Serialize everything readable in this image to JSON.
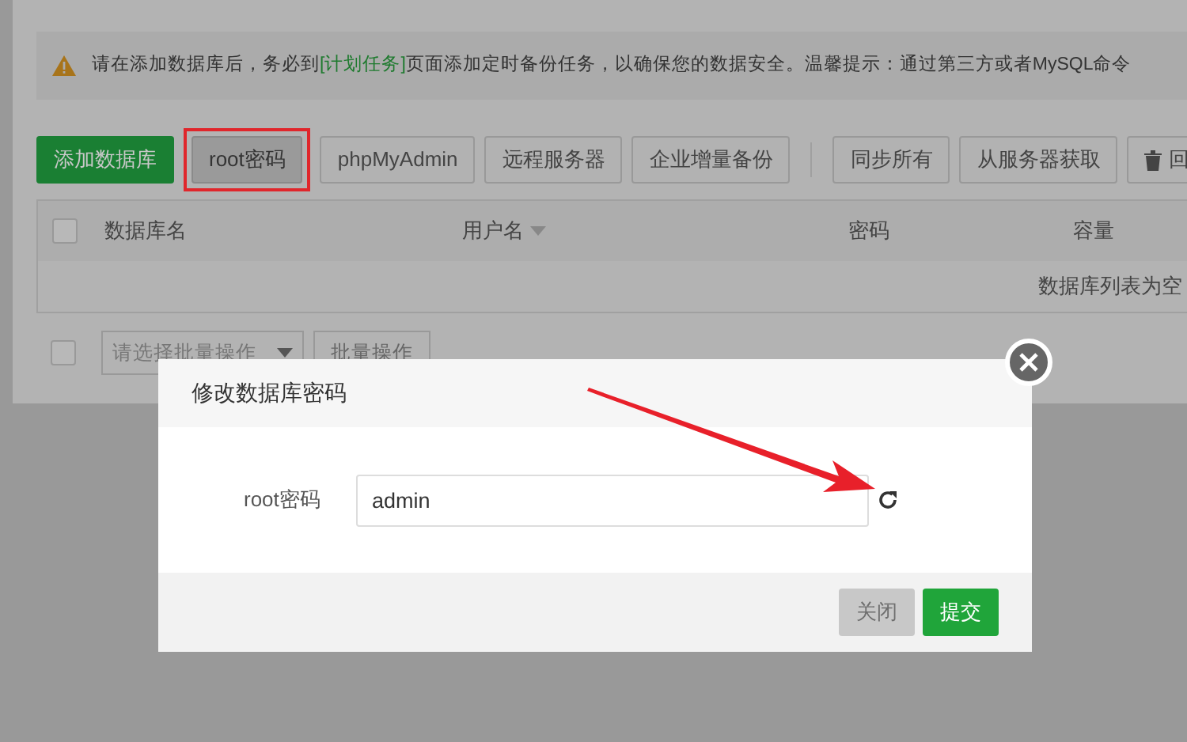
{
  "notice": {
    "parts": [
      {
        "text": "请在添加数据库后，务必到",
        "kind": "plain"
      },
      {
        "text": "[计划任务]",
        "kind": "link"
      },
      {
        "text": "页面添加定时备份任务，以确保您的数据安全。温馨提示：通过第三方或者MySQL命令",
        "kind": "plain"
      }
    ]
  },
  "toolbar": [
    {
      "label": "添加数据库",
      "kind": "primary",
      "highlighted": false
    },
    {
      "label": "root密码",
      "kind": "active",
      "highlighted": true
    },
    {
      "label": "phpMyAdmin",
      "kind": "plain",
      "highlighted": false
    },
    {
      "label": "远程服务器",
      "kind": "plain",
      "highlighted": false
    },
    {
      "label": "企业增量备份",
      "kind": "plain",
      "highlighted": false
    },
    {
      "label": "同步所有",
      "kind": "plain",
      "highlighted": false
    },
    {
      "label": "从服务器获取",
      "kind": "plain",
      "highlighted": false
    },
    {
      "label": "回",
      "kind": "trash",
      "highlighted": false
    }
  ],
  "table": {
    "columns": [
      {
        "label": "数据库名",
        "sortable": false
      },
      {
        "label": "用户名",
        "sortable": true
      },
      {
        "label": "密码",
        "sortable": false
      },
      {
        "label": "容量",
        "sortable": false
      }
    ],
    "empty_text": "数据库列表为空",
    "select_all_checked": false
  },
  "batch": {
    "checked": false,
    "placeholder": "请选择批量操作",
    "button": "批量操作"
  },
  "dialog": {
    "title": "修改数据库密码",
    "field_label": "root密码",
    "field_value": "admin",
    "buttons": [
      {
        "label": "关闭",
        "kind": "disabled"
      },
      {
        "label": "提交",
        "kind": "primary"
      }
    ]
  }
}
